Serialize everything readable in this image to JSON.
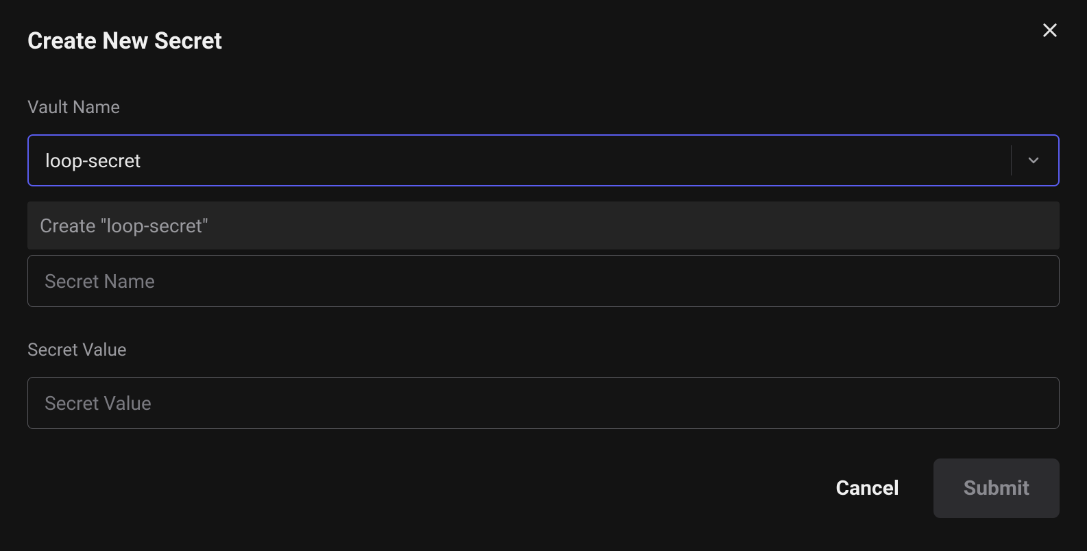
{
  "modal": {
    "title": "Create New Secret"
  },
  "fields": {
    "vault_name": {
      "label": "Vault Name",
      "value": "loop-secret",
      "dropdown_option": "Create \"loop-secret\""
    },
    "secret_name": {
      "placeholder": "Secret Name",
      "value": ""
    },
    "secret_value": {
      "label": "Secret Value",
      "placeholder": "Secret Value",
      "value": ""
    }
  },
  "buttons": {
    "cancel": "Cancel",
    "submit": "Submit"
  }
}
